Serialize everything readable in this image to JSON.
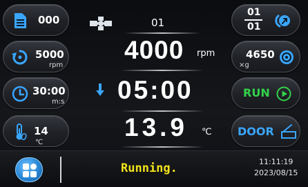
{
  "left_panel": {
    "program": {
      "value": "000",
      "icon": "document-icon"
    },
    "speed": {
      "value": "5000",
      "unit": "rpm",
      "icon": "rotation-icon"
    },
    "time": {
      "value": "30:00",
      "unit": "m:s",
      "icon": "clock-icon"
    },
    "temperature": {
      "value": "14",
      "unit": "℃",
      "icon": "thermometer-icon"
    }
  },
  "center": {
    "rotor_number": "01",
    "rotor_icon": "rotor-icon",
    "speed_value": "4000",
    "speed_unit": "rpm",
    "time_direction_icon": "down-arrow-icon",
    "time_value": "05:00",
    "temp_value": "13.9",
    "temp_unit": "℃"
  },
  "right_panel": {
    "cycle_top": "01",
    "cycle_bottom": "01",
    "cycle_icon": "cycle-icon",
    "rcf_value": "4650",
    "rcf_unit": "×g",
    "rcf_icon": "rcf-icon",
    "run_label": "RUN",
    "run_icon": "play-icon",
    "door_label": "DOOR",
    "door_icon": "door-icon"
  },
  "status_bar": {
    "menu_icon": "menu-icon",
    "status_text": "Running.",
    "time": "11:11:19",
    "date": "2023/08/15"
  },
  "colors": {
    "accent_blue": "#3aa6ff",
    "run_green": "#33d24a",
    "status_yellow": "#f2e21c"
  }
}
